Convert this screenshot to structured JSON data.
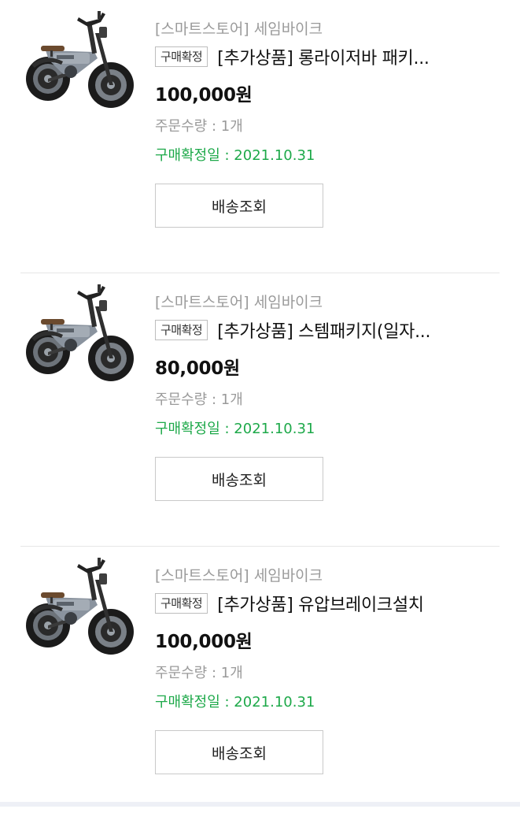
{
  "orders": [
    {
      "store": "[스마트스토어] 세임바이크",
      "badge": "구매확정",
      "title": "[추가상품] 롱라이저바 패키...",
      "price": "100,000원",
      "quantity": "주문수량 : 1개",
      "confirm_date": "구매확정일 : 2021.10.31",
      "button_label": "배송조회",
      "image_icon": "electric-bike-image"
    },
    {
      "store": "[스마트스토어] 세임바이크",
      "badge": "구매확정",
      "title": "[추가상품] 스템패키지(일자...",
      "price": "80,000원",
      "quantity": "주문수량 : 1개",
      "confirm_date": "구매확정일 : 2021.10.31",
      "button_label": "배송조회",
      "image_icon": "electric-bike-image"
    },
    {
      "store": "[스마트스토어] 세임바이크",
      "badge": "구매확정",
      "title": "[추가상품] 유압브레이크설치",
      "price": "100,000원",
      "quantity": "주문수량 : 1개",
      "confirm_date": "구매확정일 : 2021.10.31",
      "button_label": "배송조회",
      "image_icon": "electric-bike-image"
    }
  ],
  "colors": {
    "confirm_green": "#1ea94a",
    "muted_gray": "#9a9a9a",
    "bike_frame": "#8a939e"
  }
}
